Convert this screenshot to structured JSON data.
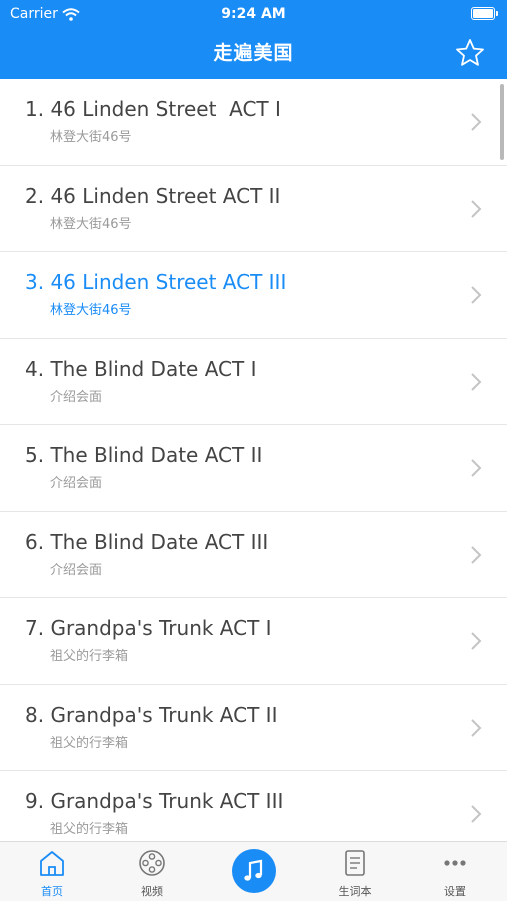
{
  "status": {
    "carrier": "Carrier",
    "time": "9:24 AM"
  },
  "nav": {
    "title": "走遍美国"
  },
  "lessons": [
    {
      "title": "1. 46 Linden Street  ACT I",
      "subtitle": "林登大街46号",
      "active": false
    },
    {
      "title": "2. 46 Linden Street ACT II",
      "subtitle": "林登大街46号",
      "active": false
    },
    {
      "title": "3. 46 Linden Street ACT III",
      "subtitle": "林登大街46号",
      "active": true
    },
    {
      "title": "4. The Blind Date ACT I",
      "subtitle": "介绍会面",
      "active": false
    },
    {
      "title": "5. The Blind Date ACT II",
      "subtitle": "介绍会面",
      "active": false
    },
    {
      "title": "6. The Blind Date ACT III",
      "subtitle": "介绍会面",
      "active": false
    },
    {
      "title": "7. Grandpa's Trunk ACT I",
      "subtitle": "祖父的行李箱",
      "active": false
    },
    {
      "title": "8. Grandpa's Trunk ACT II",
      "subtitle": "祖父的行李箱",
      "active": false
    },
    {
      "title": "9. Grandpa's Trunk ACT III",
      "subtitle": "祖父的行李箱",
      "active": false
    }
  ],
  "tabs": [
    {
      "label": "首页",
      "icon": "home-icon",
      "active": true
    },
    {
      "label": "视频",
      "icon": "film-reel-icon",
      "active": false
    },
    {
      "label": "",
      "icon": "music-note-icon",
      "active": false
    },
    {
      "label": "生词本",
      "icon": "notebook-icon",
      "active": false
    },
    {
      "label": "设置",
      "icon": "more-dots-icon",
      "active": false
    }
  ],
  "colors": {
    "accent": "#1a8cf6",
    "text": "#444444",
    "subtext": "#9a9a9a"
  }
}
